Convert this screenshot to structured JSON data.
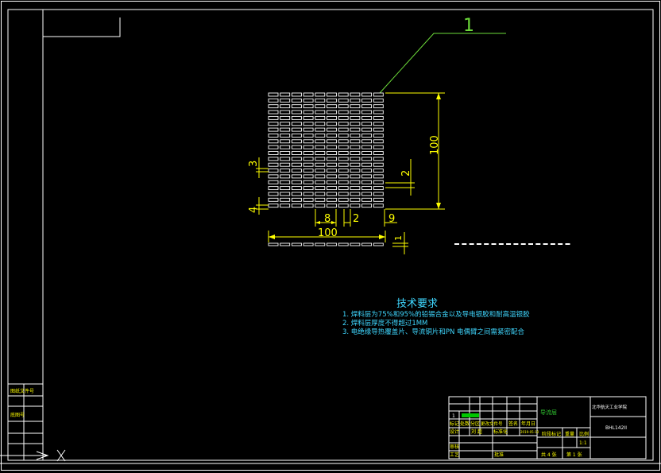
{
  "drawing": {
    "balloon_number": "1",
    "dimensions": {
      "overall_height": "100",
      "overall_width": "100",
      "cell_width": "8",
      "gap": "2",
      "pitch_right": "9",
      "row_gap": "2",
      "dim_3": "3",
      "dim_4": "4",
      "strip_thickness": "1"
    }
  },
  "tech_requirements": {
    "title": "技术要求",
    "lines": [
      "1. 焊料层为75%和95%的铅锡合金以及导电银胶和耐高温银胶",
      "2. 焊料层厚度不得超过1MM",
      "3. 电绝缘导热覆盖片、导流铜片和PN 电偶臂之间需紧密配合"
    ]
  },
  "side_block": {
    "label_a": "图纸文件号",
    "label_b": "底图号"
  },
  "title_block": {
    "material": "导流层",
    "company": "北华航天工业学院",
    "drawing_code": "BHL142II",
    "row_number": "1",
    "header_cells": [
      "标记",
      "处数",
      "分区",
      "更改文件号",
      "签名",
      "年月日"
    ],
    "designer_label": "设计",
    "designer_name": "刘 超",
    "standardization_label": "标准化",
    "date_value": "2019-05-10",
    "stage_label": "阶段标记",
    "weight_label": "重量",
    "scale_label": "比例",
    "scale_value": "1:1",
    "review_label": "审核",
    "process_label": "工艺",
    "approve_label": "批准",
    "sheets_total": "共 4 张",
    "sheet_number": "第 1 张"
  },
  "colors": {
    "line_white": "#ffffff",
    "dim_yellow": "#ffff00",
    "leader_green": "#6ddc3a",
    "text_cyan": "#3fd7ff",
    "material_green": "#2fc52f",
    "fill_green": "#00c800"
  }
}
